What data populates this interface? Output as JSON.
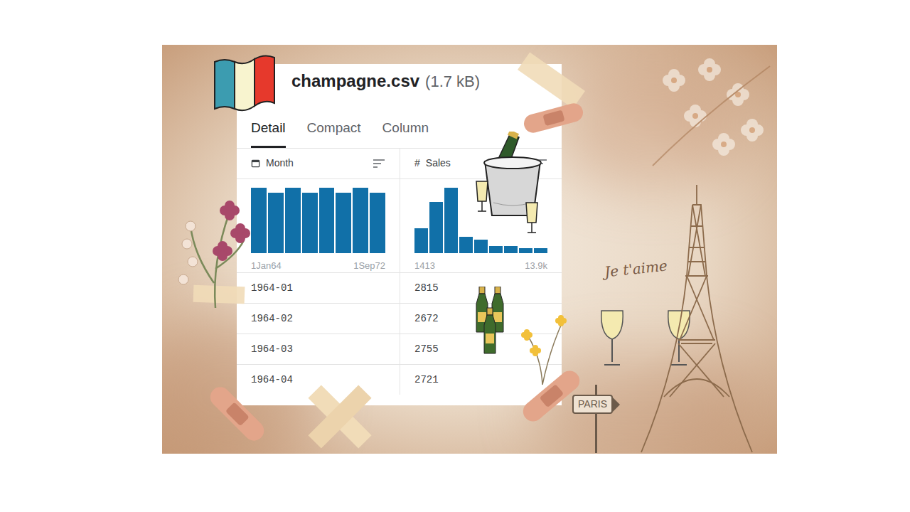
{
  "file": {
    "name": "champagne.csv",
    "size": "(1.7 kB)"
  },
  "tabs": [
    {
      "label": "Detail",
      "selected": true
    },
    {
      "label": "Compact",
      "selected": false
    },
    {
      "label": "Column",
      "selected": false
    }
  ],
  "columns": [
    {
      "name": "Month",
      "kind": "date",
      "histogram": [
        12,
        11,
        12,
        11,
        12,
        11,
        12,
        11
      ],
      "range": [
        "1Jan64",
        "1Sep72"
      ]
    },
    {
      "name": "Sales",
      "kind": "number",
      "symbol": "#",
      "histogram": [
        15,
        31,
        40,
        10,
        8,
        4,
        4,
        3,
        3
      ],
      "range": [
        "1413",
        "13.9k"
      ]
    }
  ],
  "rows": [
    [
      "1964-01",
      "2815"
    ],
    [
      "1964-02",
      "2672"
    ],
    [
      "1964-03",
      "2755"
    ],
    [
      "1964-04",
      "2721"
    ]
  ],
  "stickers": {
    "love_text": "Je t'aime",
    "sign_text": "PARIS"
  }
}
